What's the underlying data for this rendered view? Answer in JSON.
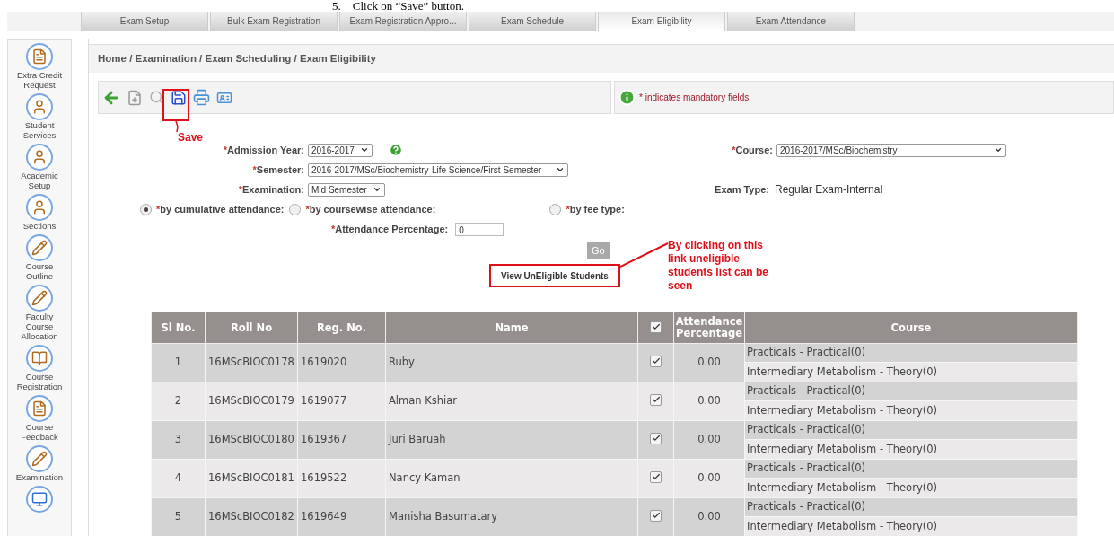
{
  "instruction": "5.    Click on “Save” button.",
  "tabs": [
    {
      "label": "Exam Setup",
      "selected": false
    },
    {
      "label": "Bulk Exam Registration",
      "selected": false
    },
    {
      "label": "Exam Registration Appro...",
      "selected": false
    },
    {
      "label": "Exam Schedule",
      "selected": false
    },
    {
      "label": "Exam Eligibility",
      "selected": true
    },
    {
      "label": "Exam Attendance",
      "selected": false
    }
  ],
  "sidebar": {
    "items": [
      {
        "label": "Extra Credit Request"
      },
      {
        "label": "Student Services"
      },
      {
        "label": "Academic Setup"
      },
      {
        "label": "Sections"
      },
      {
        "label": "Course Outline"
      },
      {
        "label": "Faculty Course Allocation"
      },
      {
        "label": "Course Registration"
      },
      {
        "label": "Course Feedback"
      },
      {
        "label": "Examination"
      }
    ]
  },
  "breadcrumb": "Home / Examination / Exam Scheduling / Exam Eligibility",
  "mandatory_note": "* indicates mandatory fields",
  "annotations": {
    "save_label": "Save",
    "link_note": "By clicking on this link uneligible students list can be seen"
  },
  "form": {
    "admission_year": {
      "mark": "*",
      "label": "Admission Year:",
      "value": "2016-2017"
    },
    "semester": {
      "mark": "*",
      "label": "Semester:",
      "value": "2016-2017/MSc/Biochemistry-Life Science/First Semester"
    },
    "examination": {
      "mark": "*",
      "label": "Examination:",
      "value": "Mid Semester"
    },
    "course": {
      "mark": "*",
      "label": "Course:",
      "value": "2016-2017/MSc/Biochemistry"
    },
    "exam_type": {
      "label": "Exam Type:",
      "value": "Regular Exam-Internal"
    },
    "attendance_options": [
      {
        "mark": "*",
        "label": "by cumulative attendance:",
        "selected": true
      },
      {
        "mark": "*",
        "label": "by coursewise attendance:",
        "selected": false
      },
      {
        "mark": "*",
        "label": "by fee type:",
        "selected": false
      }
    ],
    "attendance_percentage": {
      "mark": "*",
      "label": "Attendance Percentage:",
      "value": "0"
    },
    "go_button": {
      "label": "Go",
      "disabled": true
    },
    "link": "View UnEligible Students"
  },
  "table": {
    "columns": [
      "Sl No.",
      "Roll No",
      "Reg. No.",
      "Name",
      "",
      "Attendance Percentage",
      "Course"
    ],
    "header_checked": true,
    "rows": [
      {
        "sl": "1",
        "roll": "16MScBIOC0178",
        "reg": "1619020",
        "name": "Ruby",
        "checked": true,
        "attendance": "0.00",
        "courses": [
          "Practicals - Practical(0)",
          "Intermediary Metabolism - Theory(0)"
        ]
      },
      {
        "sl": "2",
        "roll": "16MScBIOC0179",
        "reg": "1619077",
        "name": "Alman Kshiar",
        "checked": true,
        "attendance": "0.00",
        "courses": [
          "Practicals - Practical(0)",
          "Intermediary Metabolism - Theory(0)"
        ]
      },
      {
        "sl": "3",
        "roll": "16MScBIOC0180",
        "reg": "1619367",
        "name": "Juri Baruah",
        "checked": true,
        "attendance": "0.00",
        "courses": [
          "Practicals - Practical(0)",
          "Intermediary Metabolism - Theory(0)"
        ]
      },
      {
        "sl": "4",
        "roll": "16MScBIOC0181",
        "reg": "1619522",
        "name": "Nancy Kaman",
        "checked": true,
        "attendance": "0.00",
        "courses": [
          "Practicals - Practical(0)",
          "Intermediary Metabolism - Theory(0)"
        ]
      },
      {
        "sl": "5",
        "roll": "16MScBIOC0182",
        "reg": "1619649",
        "name": "Manisha Basumatary",
        "checked": true,
        "attendance": "0.00",
        "courses": [
          "Practicals - Practical(0)",
          "Intermediary Metabolism - Theory(0)"
        ]
      }
    ]
  }
}
